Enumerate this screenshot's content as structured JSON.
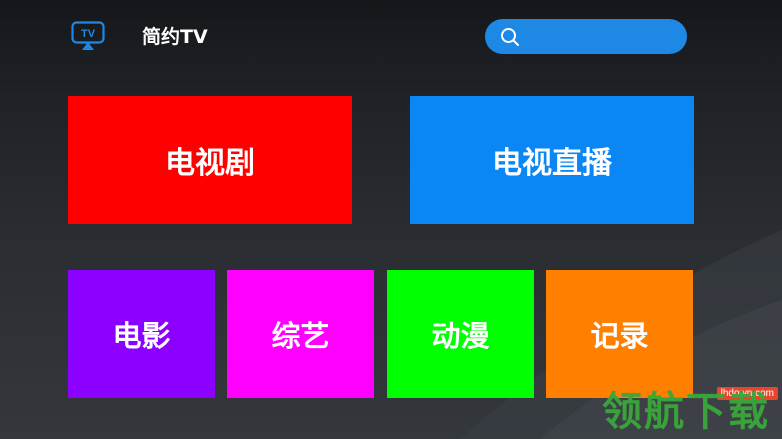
{
  "header": {
    "logo_text": "TV",
    "title": "简约TV",
    "search": {
      "placeholder": "",
      "icon": "search-icon"
    }
  },
  "tiles": [
    {
      "id": "tv-series",
      "label": "电视剧",
      "color": "#ff0000"
    },
    {
      "id": "live-tv",
      "label": "电视直播",
      "color": "#0a87f5"
    },
    {
      "id": "movies",
      "label": "电影",
      "color": "#8b00ff"
    },
    {
      "id": "variety",
      "label": "综艺",
      "color": "#ff00ff"
    },
    {
      "id": "anime",
      "label": "动漫",
      "color": "#00ff00"
    },
    {
      "id": "documentary",
      "label": "记录",
      "color": "#ff8000"
    }
  ],
  "watermark": {
    "url": "lhdown.com",
    "brand": "领航下载"
  },
  "colors": {
    "accent": "#1e88e5",
    "logo": "#1e88e5",
    "watermark_green": "#3aa83a",
    "watermark_red": "#e8462c"
  }
}
